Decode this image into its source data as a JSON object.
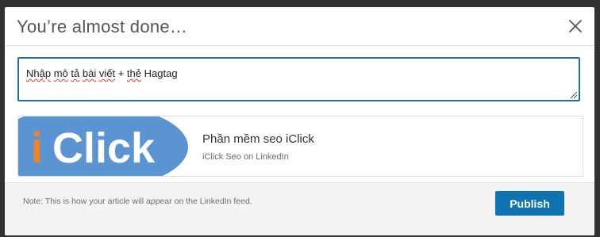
{
  "modal": {
    "title": "You’re almost done…",
    "close_icon": "close-icon"
  },
  "description": {
    "words": [
      "Nhập",
      "mô",
      "tả",
      "bài",
      "viết",
      "+",
      "thẻ",
      "Hagtag"
    ]
  },
  "preview": {
    "thumbnail_text_orange": "i",
    "thumbnail_text_white": "Click",
    "title": "Phần mềm seo iClick",
    "subtitle": "iClick Seo on LinkedIn"
  },
  "footer": {
    "note": "Note: This is how your article will appear on the LinkedIn feed.",
    "publish_label": "Publish"
  },
  "colors": {
    "accent": "#0e73b0",
    "focus_border": "#1f6fa7",
    "thumbnail_bg": "#5b94d3",
    "thumbnail_orange": "#f58220",
    "backdrop": "#2f3133"
  }
}
